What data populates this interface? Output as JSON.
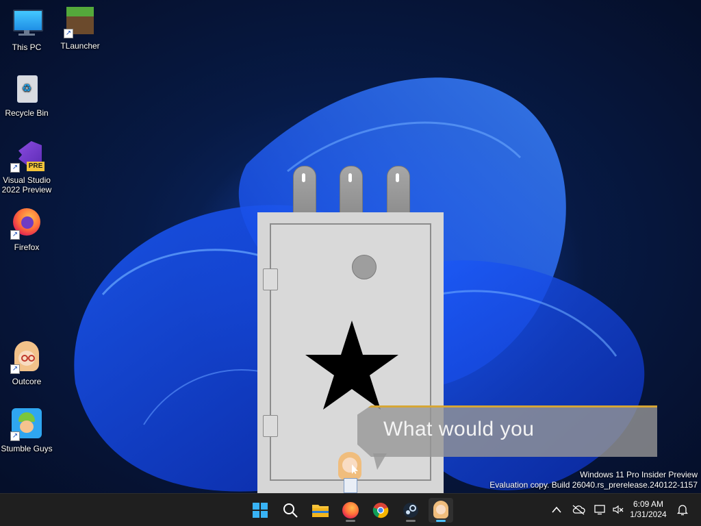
{
  "desktop": {
    "icons": [
      {
        "label": "This PC",
        "icon": "monitor-icon"
      },
      {
        "label": "TLauncher",
        "icon": "tlauncher-icon"
      },
      {
        "label": "Recycle Bin",
        "icon": "recycle-bin-icon"
      },
      {
        "label": "Visual Studio 2022 Preview",
        "icon": "visual-studio-icon",
        "badge": "PRE"
      },
      {
        "label": "Firefox",
        "icon": "firefox-icon"
      },
      {
        "label": "Outcore",
        "icon": "outcore-icon"
      },
      {
        "label": "Stumble Guys",
        "icon": "stumble-guys-icon"
      }
    ]
  },
  "app": {
    "dialog_text": "What would you",
    "colors": {
      "safe_body": "#d6d6d6",
      "bolt": "#9b9b9b",
      "dialog_accent": "#d6a635"
    }
  },
  "watermark": {
    "line1": "Windows 11 Pro Insider Preview",
    "line2": "Evaluation copy. Build 26040.rs_prerelease.240122-1157"
  },
  "taskbar": {
    "pinned": [
      {
        "name": "start-button",
        "icon": "windows-logo-icon"
      },
      {
        "name": "search-button",
        "icon": "search-icon"
      },
      {
        "name": "file-explorer-button",
        "icon": "folder-icon"
      },
      {
        "name": "firefox-taskbar-button",
        "icon": "firefox-icon"
      },
      {
        "name": "chrome-taskbar-button",
        "icon": "chrome-icon"
      },
      {
        "name": "steam-taskbar-button",
        "icon": "steam-icon"
      },
      {
        "name": "outcore-taskbar-button",
        "icon": "outcore-icon"
      }
    ],
    "tray": {
      "chevron_icon": "chevron-up-icon",
      "icons": [
        "cloud-off-icon",
        "network-icon",
        "volume-muted-icon",
        "notification-icon"
      ]
    },
    "clock": {
      "time": "6:09 AM",
      "date": "1/31/2024"
    }
  }
}
